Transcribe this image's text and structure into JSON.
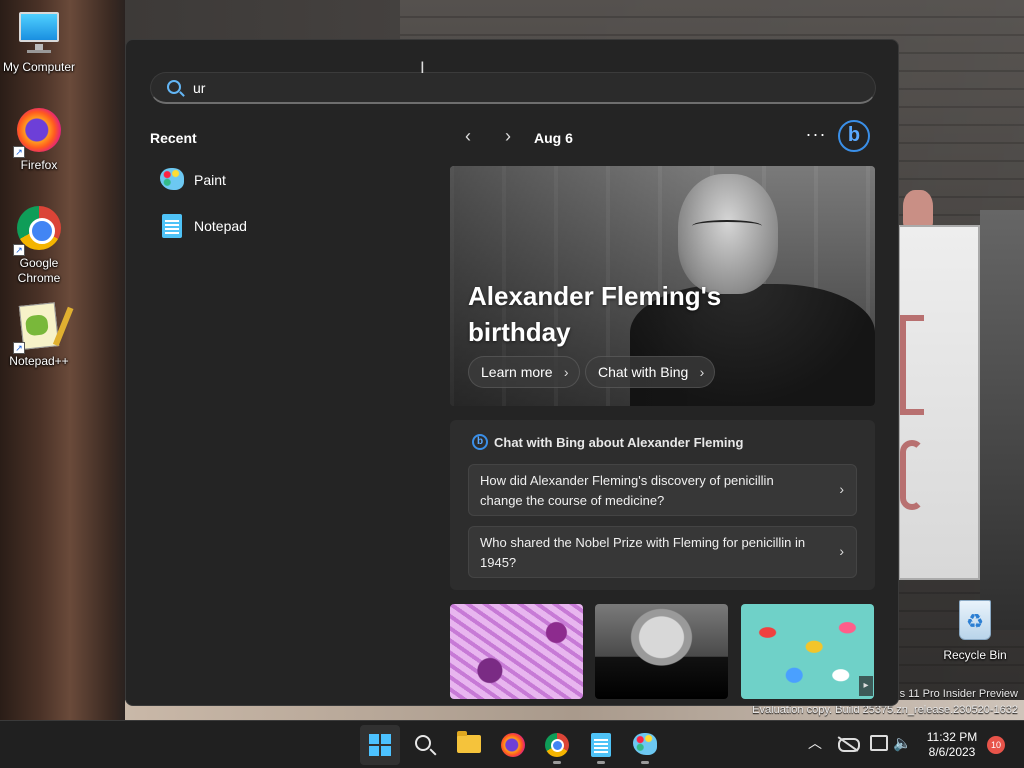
{
  "desktop": {
    "icons": [
      {
        "label": "My Computer",
        "icon": "computer-icon"
      },
      {
        "label": "Firefox",
        "icon": "firefox-icon"
      },
      {
        "label": "Google Chrome",
        "icon": "chrome-icon"
      },
      {
        "label": "Notepad++",
        "icon": "notepad-plus-plus-icon"
      },
      {
        "label": "Recycle Bin",
        "icon": "recycle-bin-icon"
      }
    ],
    "shortcut_arrow": "↗",
    "watermark_line1": "s 11 Pro Insider Preview",
    "watermark_line2": "Evaluation copy. Build 25375.zn_release.230520-1632"
  },
  "start_menu": {
    "search": {
      "value": "ur",
      "placeholder": ""
    },
    "text_cursor": "I",
    "recent_title": "Recent",
    "recent_items": [
      {
        "label": "Paint",
        "icon": "paint-icon"
      },
      {
        "label": "Notepad",
        "icon": "notepad-icon"
      }
    ],
    "date_nav": {
      "prev": "‹",
      "next": "›",
      "date": "Aug 6"
    },
    "more_glyph": "···",
    "bing_glyph": "b",
    "hero": {
      "title": "Alexander Fleming's birthday",
      "buttons": [
        {
          "label": "Learn more",
          "chevron": "›"
        },
        {
          "label": "Chat with Bing",
          "chevron": "›"
        }
      ]
    },
    "chat": {
      "heading": "Chat with Bing about Alexander Fleming",
      "bing_glyph": "b",
      "questions": [
        {
          "text": "How did Alexander Fleming's discovery of penicillin change the course of medicine?",
          "chevron": "›"
        },
        {
          "text": "Who shared the Nobel Prize with Fleming for penicillin in 1945?",
          "chevron": "›"
        }
      ]
    },
    "thumbs_scroll": "▸"
  },
  "taskbar": {
    "apps": [
      "start-icon",
      "search-icon",
      "file-explorer-icon",
      "firefox-icon",
      "chrome-icon",
      "notepad-icon",
      "paint-icon"
    ],
    "tray_up": "︿",
    "volume_glyph": "🔈",
    "time": "11:32 PM",
    "date": "8/6/2023",
    "notification_count": "10"
  },
  "colors": {
    "accent": "#4cc2ff",
    "start_bg": "#242424",
    "taskbar_bg": "#202020",
    "notification": "#e8544a"
  }
}
